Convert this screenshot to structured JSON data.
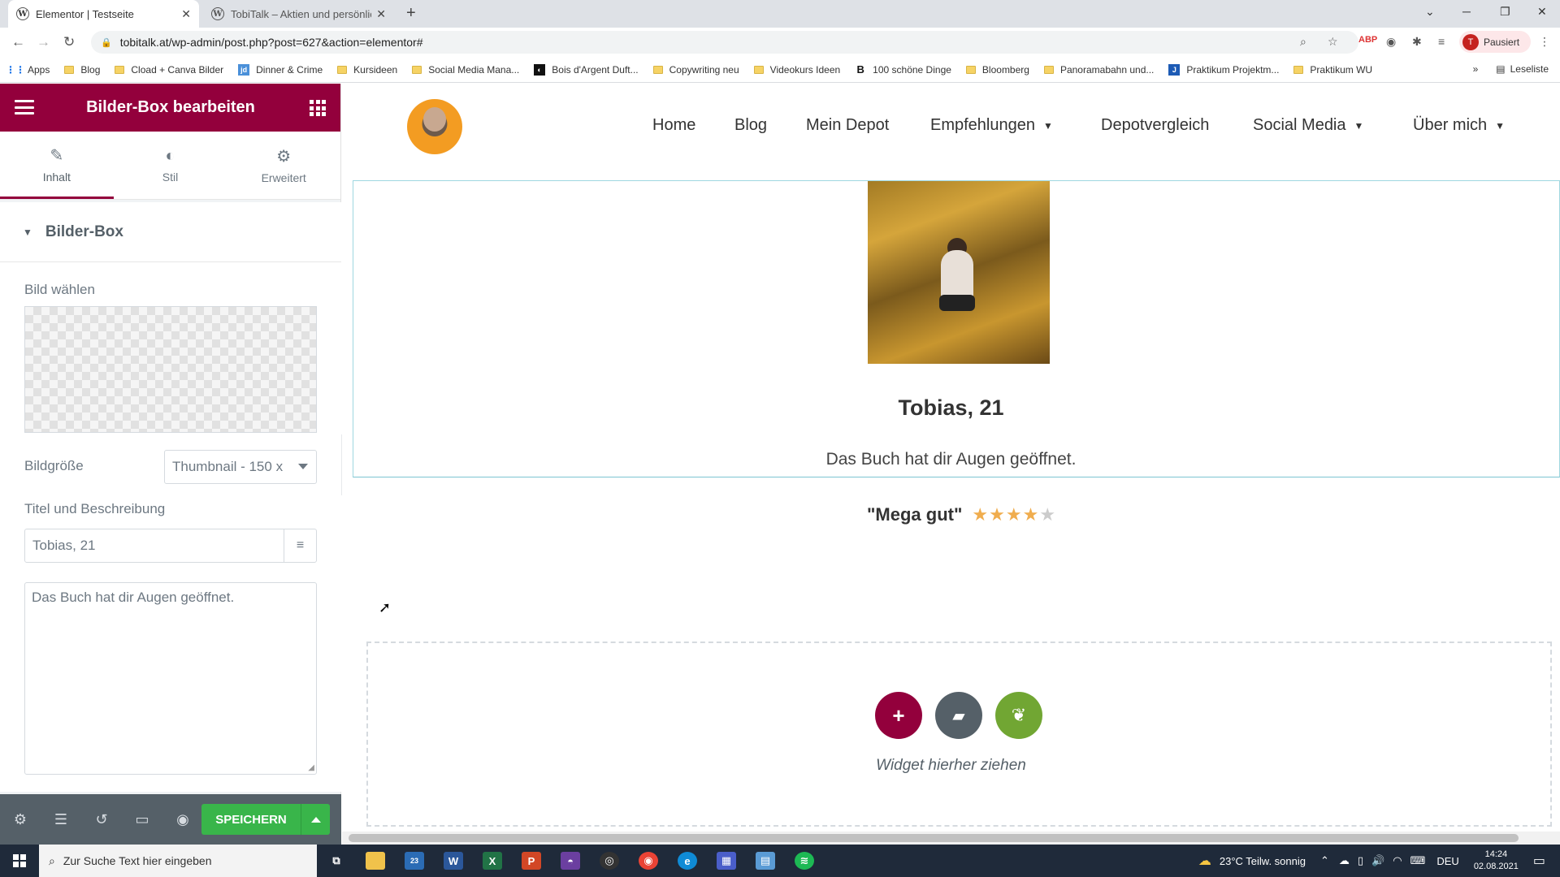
{
  "browser": {
    "tabs": [
      {
        "title": "Elementor | Testseite",
        "active": true
      },
      {
        "title": "TobiTalk – Aktien und persönliche",
        "active": false
      }
    ],
    "url": "tobitalk.at/wp-admin/post.php?post=627&action=elementor#",
    "profile_initial": "T",
    "profile_label": "Pausiert",
    "bookmarks": [
      "Apps",
      "Blog",
      "Cload + Canva Bilder",
      "Dinner & Crime",
      "Kursideen",
      "Social Media Mana...",
      "Bois d'Argent Duft...",
      "Copywriting neu",
      "Videokurs Ideen",
      "100 schöne Dinge",
      "Bloomberg",
      "Panoramabahn und...",
      "Praktikum Projektm...",
      "Praktikum WU"
    ],
    "reading_list": "Leseliste"
  },
  "panel": {
    "title": "Bilder-Box bearbeiten",
    "tabs": [
      {
        "label": "Inhalt",
        "icon": "pencil-icon"
      },
      {
        "label": "Stil",
        "icon": "contrast-icon"
      },
      {
        "label": "Erweitert",
        "icon": "gear-icon"
      }
    ],
    "section_title": "Bilder-Box",
    "image_label": "Bild wählen",
    "size_label": "Bildgröße",
    "size_value": "Thumbnail - 150 x",
    "title_desc_label": "Titel und Beschreibung",
    "title_value": "Tobias, 21",
    "desc_value": "Das Buch hat dir Augen geöffnet.",
    "save_label": "SPEICHERN"
  },
  "site": {
    "nav": [
      {
        "label": "Home",
        "dropdown": false
      },
      {
        "label": "Blog",
        "dropdown": false
      },
      {
        "label": "Mein Depot",
        "dropdown": false
      },
      {
        "label": "Empfehlungen",
        "dropdown": true
      },
      {
        "label": "Depotvergleich",
        "dropdown": false
      },
      {
        "label": "Social Media",
        "dropdown": true
      },
      {
        "label": "Über mich",
        "dropdown": true
      }
    ],
    "box_title": "Tobias, 21",
    "box_desc": "Das Buch hat dir Augen geöffnet.",
    "quote": "\"Mega gut\"",
    "rating": 4.5,
    "drop_text": "Widget hierher ziehen"
  },
  "taskbar": {
    "search_placeholder": "Zur Suche Text hier eingeben",
    "weather": "23°C  Teilw. sonnig",
    "lang": "DEU",
    "time": "14:24",
    "date": "02.08.2021",
    "mail_badge": "23"
  },
  "colors": {
    "elementor_accent": "#93003c",
    "save_green": "#39b54a",
    "star": "#f0ad4e",
    "template_green": "#71a633"
  }
}
